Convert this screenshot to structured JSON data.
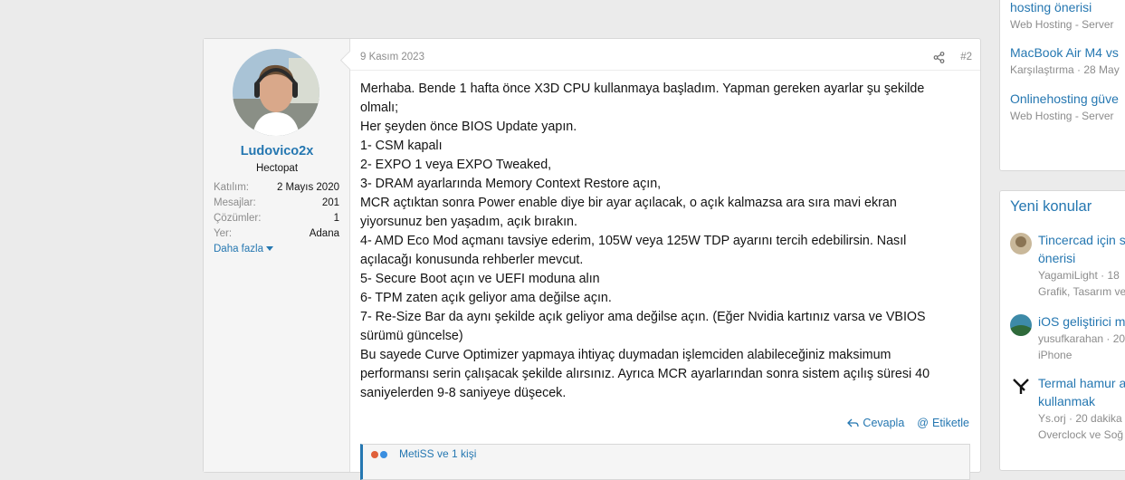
{
  "post": {
    "date": "9 Kasım 2023",
    "number": "#2",
    "user": {
      "name": "Ludovico2x",
      "title": "Hectopat",
      "stats": [
        {
          "label": "Katılım:",
          "value": "2 Mayıs 2020"
        },
        {
          "label": "Mesajlar:",
          "value": "201"
        },
        {
          "label": "Çözümler:",
          "value": "1"
        },
        {
          "label": "Yer:",
          "value": "Adana"
        }
      ],
      "more_label": "Daha fazla"
    },
    "body_lines": [
      "Merhaba. Bende 1 hafta önce X3D CPU kullanmaya başladım. Yapman gereken ayarlar şu şekilde olmalı;",
      "Her şeyden önce BIOS Update yapın.",
      "1- CSM kapalı",
      "2- EXPO 1 veya EXPO Tweaked,",
      "3- DRAM ayarlarında Memory Context Restore açın,",
      "MCR açtıktan sonra Power enable diye bir ayar açılacak, o açık kalmazsa ara sıra mavi ekran yiyorsunuz ben yaşadım, açık bırakın.",
      "4- AMD Eco Mod açmanı tavsiye ederim, 105W veya 125W TDP ayarını tercih edebilirsin. Nasıl açılacağı konusunda rehberler mevcut.",
      "5- Secure Boot açın ve UEFI moduna alın",
      "6- TPM zaten açık geliyor ama değilse açın.",
      "7- Re-Size Bar da aynı şekilde açık geliyor ama değilse açın. (Eğer Nvidia kartınız varsa ve VBIOS sürümü güncelse)",
      "Bu sayede Curve Optimizer yapmaya ihtiyaç duymadan işlemciden alabileceğiniz maksimum performansı serin çalışacak şekilde alırsınız. Ayrıca MCR ayarlarından sonra sistem açılış süresi 40 saniyelerden 9-8 saniyeye düşecek."
    ],
    "actions": {
      "reply": "Cevapla",
      "mention": "Etiketle"
    },
    "quote_partial": "MetiSS ve 1 kişi"
  },
  "sidebar_top": {
    "items": [
      {
        "title": "hosting önerisi",
        "meta": "Web Hosting - Server"
      },
      {
        "title": "MacBook Air M4 vs",
        "meta": "Karşılaştırma · 28 May"
      },
      {
        "title": "Onlinehosting güve",
        "meta": "Web Hosting - Server"
      }
    ]
  },
  "sidebar_new": {
    "heading": "Yeni konular",
    "threads": [
      {
        "title1": "Tincercad için s",
        "title2": "önerisi",
        "meta1": "YagamiLight · 18",
        "meta2": "Grafik, Tasarım ve"
      },
      {
        "title1": "iOS geliştirici m",
        "title2": "",
        "meta1": "yusufkarahan · 20",
        "meta2": "iPhone"
      },
      {
        "title1": "Termal hamur a",
        "title2": "kullanmak",
        "meta1": "Ys.orj · 20 dakika",
        "meta2": "Overclock ve Soğ"
      }
    ]
  },
  "colors": {
    "link": "#2577b1",
    "muted": "#8c8c8c",
    "page_bg": "#ebebeb"
  }
}
